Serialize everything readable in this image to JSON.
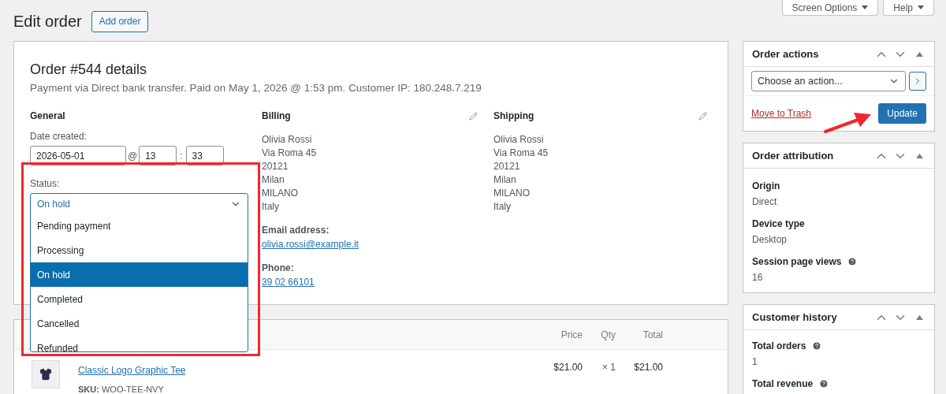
{
  "header": {
    "title": "Edit order",
    "add_button": "Add order",
    "screen_options": "Screen Options",
    "help": "Help"
  },
  "order": {
    "title": "Order #544 details",
    "subtitle": "Payment via Direct bank transfer. Paid on May 1, 2026 @ 1:53 pm. Customer IP: 180.248.7.219",
    "general": {
      "heading": "General",
      "date_label": "Date created:",
      "date": "2026-05-01",
      "at": "@",
      "hour": "13",
      "colon": ":",
      "minute": "33",
      "status_label": "Status:",
      "status_value": "On hold",
      "expanded": true,
      "options": [
        {
          "label": "Pending payment",
          "selected": false
        },
        {
          "label": "Processing",
          "selected": false
        },
        {
          "label": "On hold",
          "selected": true
        },
        {
          "label": "Completed",
          "selected": false
        },
        {
          "label": "Cancelled",
          "selected": false
        },
        {
          "label": "Refunded",
          "selected": false
        }
      ]
    },
    "billing": {
      "heading": "Billing",
      "address": [
        "Olivia Rossi",
        "Via Roma 45",
        "20121",
        "Milan",
        "MILANO",
        "Italy"
      ],
      "email_label": "Email address:",
      "email": "olivia.rossi@example.it",
      "phone_label": "Phone:",
      "phone": "39 02 66101"
    },
    "shipping": {
      "heading": "Shipping",
      "address": [
        "Olivia Rossi",
        "Via Roma 45",
        "20121",
        "Milan",
        "MILANO",
        "Italy"
      ]
    }
  },
  "items": {
    "columns": [
      "Price",
      "Qty",
      "Total"
    ],
    "rows": [
      {
        "name": "Classic Logo Graphic Tee",
        "sku_label": "SKU:",
        "sku": "WOO-TEE-NVY",
        "price": "$21.00",
        "qty": "× 1",
        "total": "$21.00"
      }
    ]
  },
  "sidebar": {
    "order_actions": {
      "title": "Order actions",
      "placeholder": "Choose an action...",
      "trash": "Move to Trash",
      "update": "Update"
    },
    "attribution": {
      "title": "Order attribution",
      "fields": [
        {
          "label": "Origin",
          "value": "Direct",
          "help": false
        },
        {
          "label": "Device type",
          "value": "Desktop",
          "help": false
        },
        {
          "label": "Session page views",
          "value": "16",
          "help": true
        }
      ]
    },
    "history": {
      "title": "Customer history",
      "fields": [
        {
          "label": "Total orders",
          "value": "1",
          "help": true
        },
        {
          "label": "Total revenue",
          "help": true
        }
      ]
    }
  }
}
